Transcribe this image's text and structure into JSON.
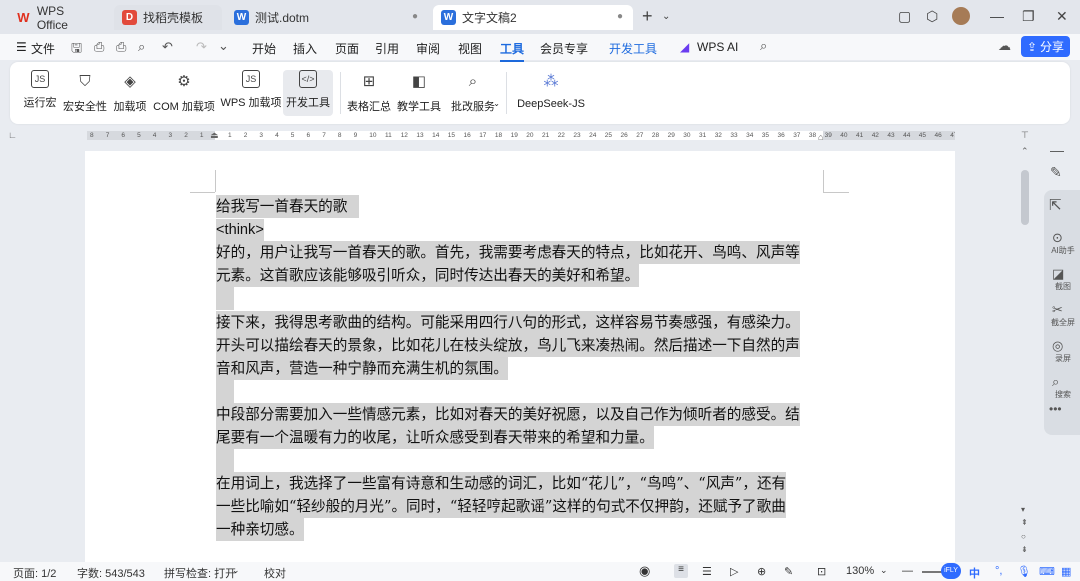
{
  "tabs": [
    {
      "label": "WPS Office",
      "icon": "wps-logo-icon"
    },
    {
      "label": "找稻壳模板",
      "icon": "docer-icon"
    },
    {
      "label": "测试.dotm",
      "icon": "word-icon"
    },
    {
      "label": "文字文稿2",
      "icon": "word-icon"
    }
  ],
  "menu": {
    "file": "文件",
    "items": [
      "开始",
      "插入",
      "页面",
      "引用",
      "审阅",
      "视图",
      "工具",
      "会员专享",
      "开发工具"
    ],
    "active": "工具",
    "wps_ai": "WPS AI",
    "share": "分享"
  },
  "ribbon": {
    "groups": [
      {
        "label": "运行宏",
        "icon": "run-macro-icon"
      },
      {
        "label": "宏安全性",
        "icon": "macro-security-icon"
      },
      {
        "label": "加载项",
        "icon": "addin-icon"
      },
      {
        "label": "COM 加载项",
        "icon": "com-addin-icon"
      },
      {
        "label": "WPS 加载项",
        "icon": "wps-addin-icon"
      },
      {
        "label": "开发工具",
        "icon": "dev-tools-icon"
      },
      {
        "label": "表格汇总",
        "icon": "table-summary-icon"
      },
      {
        "label": "教学工具",
        "icon": "teaching-tools-icon"
      },
      {
        "label": "批改服务",
        "icon": "review-service-icon"
      },
      {
        "label": "DeepSeek-JS",
        "icon": "deepseek-icon"
      }
    ]
  },
  "ruler": {
    "left": [
      "8",
      "7",
      "6",
      "5",
      "4",
      "3",
      "2",
      "1"
    ],
    "right": [
      "1",
      "2",
      "3",
      "4",
      "5",
      "6",
      "7",
      "8",
      "9",
      "10",
      "11",
      "12",
      "13",
      "14",
      "15",
      "16",
      "17",
      "18",
      "19",
      "20",
      "21",
      "22",
      "23",
      "24",
      "25",
      "26",
      "27",
      "28",
      "29",
      "30",
      "31",
      "32",
      "33",
      "34",
      "35",
      "36",
      "37",
      "38",
      "39",
      "40",
      "41",
      "42",
      "43",
      "44",
      "45",
      "46",
      "47"
    ]
  },
  "document": {
    "lines": [
      "给我写一首春天的歌",
      "<think>",
      "好的，用户让我写一首春天的歌。首先，我需要考虑春天的特点，比如花开、鸟鸣、风声等",
      "元素。这首歌应该能够吸引听众，同时传达出春天的美好和希望。",
      "",
      "接下来，我得思考歌曲的结构。可能采用四行八句的形式，这样容易节奏感强，有感染力。",
      "开头可以描绘春天的景象，比如花儿在枝头绽放，鸟儿飞来凑热闹。然后描述一下自然的声",
      "音和风声，营造一种宁静而充满生机的氛围。",
      "",
      "中段部分需要加入一些情感元素，比如对春天的美好祝愿，以及自己作为倾听者的感受。结",
      "尾要有一个温暖有力的收尾，让听众感受到春天带来的希望和力量。",
      "",
      "在用词上，我选择了一些富有诗意和生动感的词汇，比如“花儿”，“鸟鸣”、“风声”，还有",
      "一些比喻如“轻纱般的月光”。同时，“轻轻哼起歌谣”这样的句式不仅押韵，还赋予了歌曲",
      "一种亲切感。"
    ]
  },
  "sidepanel": [
    "AI助手",
    "截图",
    "截全屏",
    "录屏",
    "搜索"
  ],
  "status": {
    "page": "页面: 1/2",
    "words": "字数: 543/543",
    "spell": "拼写检查: 打开",
    "proof": "校对",
    "zoom": "130%"
  },
  "ime": {
    "lang": "中"
  },
  "colors": {
    "accent": "#1e6bdf",
    "highlight": "#d4d4d4"
  }
}
